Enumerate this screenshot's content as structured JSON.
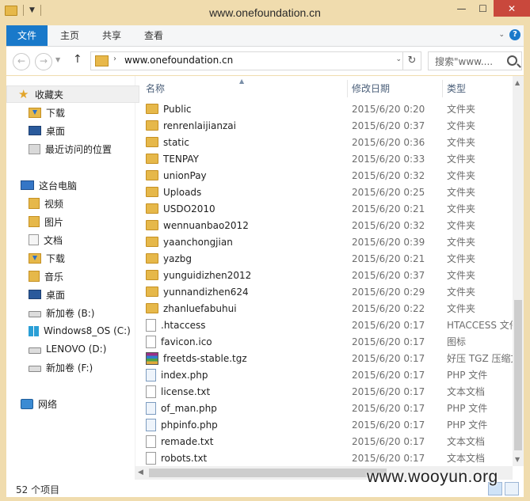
{
  "window": {
    "title": "www.onefoundation.cn",
    "minimize": "—",
    "maximize": "☐",
    "close": "✕"
  },
  "ribbon": {
    "tabs": [
      "文件",
      "主页",
      "共享",
      "查看"
    ],
    "help": "?"
  },
  "nav": {
    "back": "←",
    "forward": "→",
    "up": "↑",
    "address": "www.onefoundation.cn",
    "search_placeholder": "搜索\"www...."
  },
  "sidebar": {
    "favorites": {
      "label": "收藏夹",
      "items": [
        "下载",
        "桌面",
        "最近访问的位置"
      ]
    },
    "pc": {
      "label": "这台电脑",
      "items": [
        "视频",
        "图片",
        "文档",
        "下载",
        "音乐",
        "桌面",
        "新加卷 (B:)",
        "Windows8_OS (C:)",
        "LENOVO (D:)",
        "新加卷 (F:)"
      ]
    },
    "network": {
      "label": "网络"
    }
  },
  "columns": {
    "name": "名称",
    "date": "修改日期",
    "type": "类型"
  },
  "files": [
    {
      "name": "Public",
      "date": "2015/6/20 0:20",
      "type": "文件夹",
      "icon": "folder"
    },
    {
      "name": "renrenlaijianzai",
      "date": "2015/6/20 0:37",
      "type": "文件夹",
      "icon": "folder"
    },
    {
      "name": "static",
      "date": "2015/6/20 0:36",
      "type": "文件夹",
      "icon": "folder"
    },
    {
      "name": "TENPAY",
      "date": "2015/6/20 0:33",
      "type": "文件夹",
      "icon": "folder"
    },
    {
      "name": "unionPay",
      "date": "2015/6/20 0:32",
      "type": "文件夹",
      "icon": "folder"
    },
    {
      "name": "Uploads",
      "date": "2015/6/20 0:25",
      "type": "文件夹",
      "icon": "folder"
    },
    {
      "name": "USDO2010",
      "date": "2015/6/20 0:21",
      "type": "文件夹",
      "icon": "folder"
    },
    {
      "name": "wennuanbao2012",
      "date": "2015/6/20 0:32",
      "type": "文件夹",
      "icon": "folder"
    },
    {
      "name": "yaanchongjian",
      "date": "2015/6/20 0:39",
      "type": "文件夹",
      "icon": "folder"
    },
    {
      "name": "yazbg",
      "date": "2015/6/20 0:21",
      "type": "文件夹",
      "icon": "folder"
    },
    {
      "name": "yunguidizhen2012",
      "date": "2015/6/20 0:37",
      "type": "文件夹",
      "icon": "folder"
    },
    {
      "name": "yunnandizhen624",
      "date": "2015/6/20 0:29",
      "type": "文件夹",
      "icon": "folder"
    },
    {
      "name": "zhanluefabuhui",
      "date": "2015/6/20 0:22",
      "type": "文件夹",
      "icon": "folder"
    },
    {
      "name": ".htaccess",
      "date": "2015/6/20 0:17",
      "type": "HTACCESS 文件",
      "icon": "file"
    },
    {
      "name": "favicon.ico",
      "date": "2015/6/20 0:17",
      "type": "图标",
      "icon": "ico"
    },
    {
      "name": "freetds-stable.tgz",
      "date": "2015/6/20 0:17",
      "type": "好压 TGZ 压缩文件",
      "icon": "archive"
    },
    {
      "name": "index.php",
      "date": "2015/6/20 0:17",
      "type": "PHP 文件",
      "icon": "php"
    },
    {
      "name": "license.txt",
      "date": "2015/6/20 0:17",
      "type": "文本文档",
      "icon": "txt"
    },
    {
      "name": "of_man.php",
      "date": "2015/6/20 0:17",
      "type": "PHP 文件",
      "icon": "php"
    },
    {
      "name": "phpinfo.php",
      "date": "2015/6/20 0:17",
      "type": "PHP 文件",
      "icon": "php"
    },
    {
      "name": "remade.txt",
      "date": "2015/6/20 0:17",
      "type": "文本文档",
      "icon": "txt"
    },
    {
      "name": "robots.txt",
      "date": "2015/6/20 0:17",
      "type": "文本文档",
      "icon": "txt"
    }
  ],
  "status": {
    "count": "52 个项目"
  },
  "watermark": "www.wooyun.org"
}
